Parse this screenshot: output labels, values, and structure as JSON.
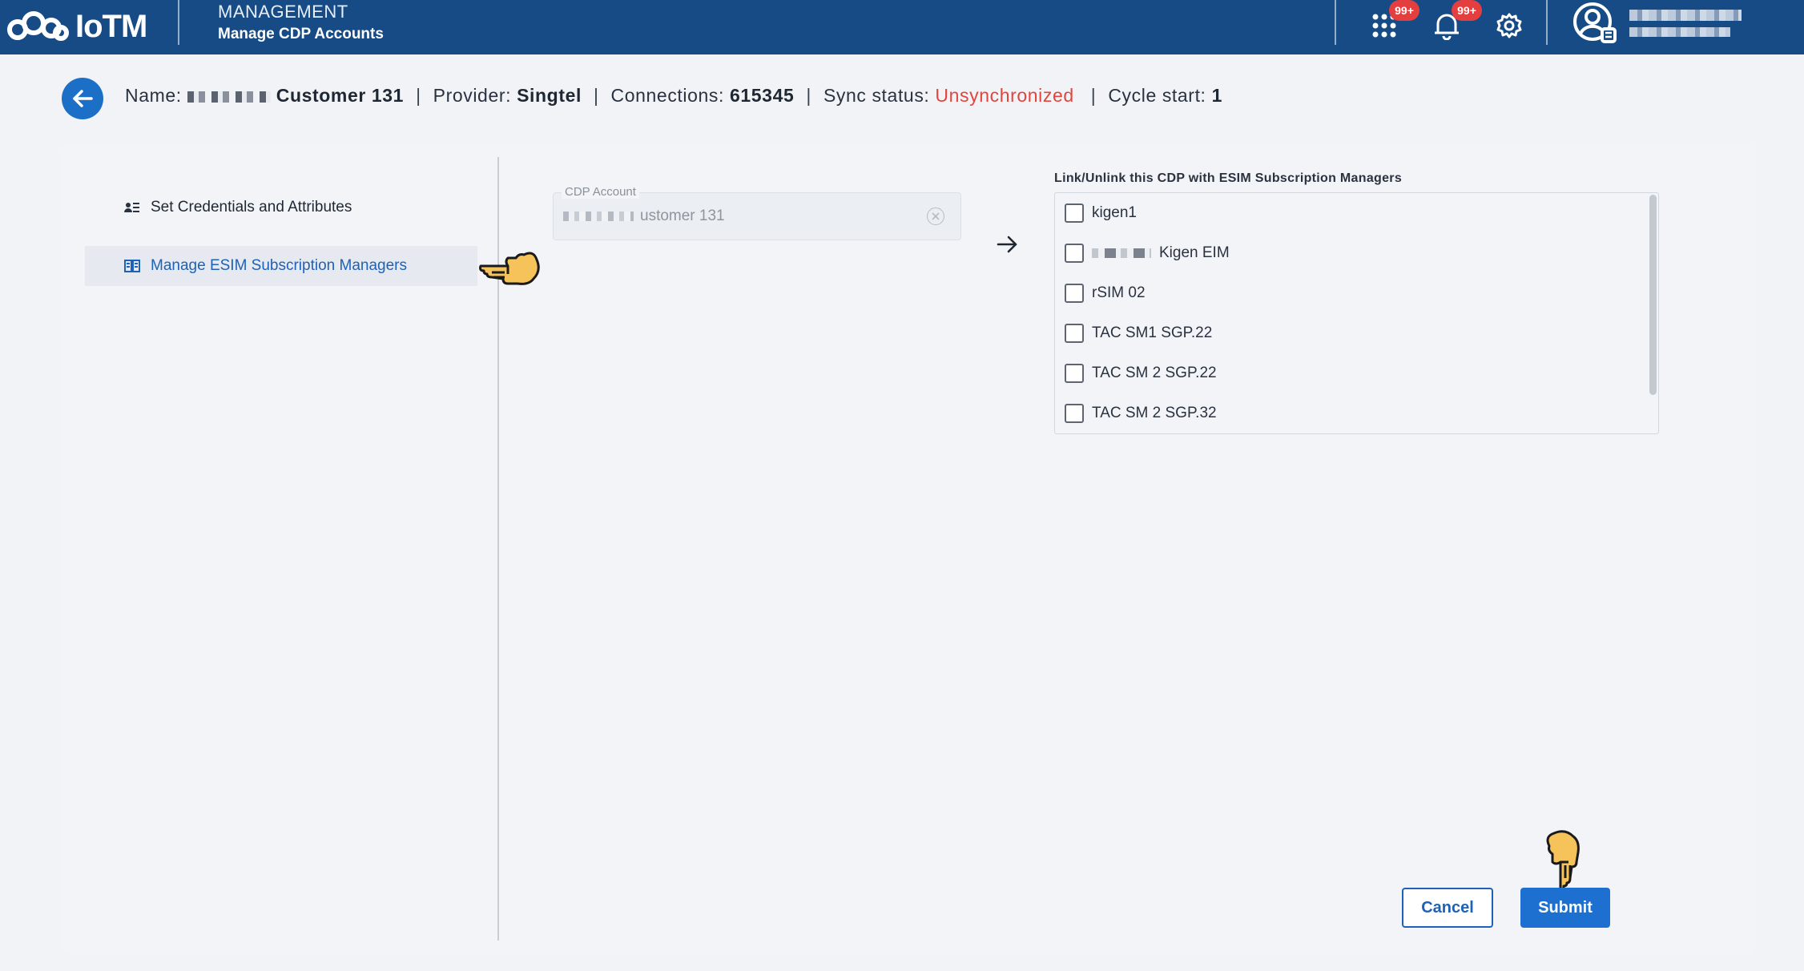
{
  "topbar": {
    "logo_text": "IoTM",
    "section": "MANAGEMENT",
    "page": "Manage CDP Accounts",
    "apps_badge": "99+",
    "notifications_badge": "99+"
  },
  "header": {
    "name_label": "Name:",
    "name_value": "Customer 131",
    "provider_label": "Provider:",
    "provider_value": "Singtel",
    "connections_label": "Connections:",
    "connections_value": "615345",
    "sync_label": "Sync status:",
    "sync_value": "Unsynchronized",
    "cycle_label": "Cycle start:",
    "cycle_value": "1",
    "separator": "|"
  },
  "sidebar": {
    "items": [
      {
        "label": "Set Credentials and Attributes",
        "icon": "user-list-icon",
        "active": false
      },
      {
        "label": "Manage ESIM Subscription Managers",
        "icon": "book-icon",
        "active": true
      }
    ]
  },
  "cdp": {
    "label": "CDP Account",
    "value_suffix": "ustomer 131"
  },
  "link_list": {
    "title": "Link/Unlink this CDP with ESIM Subscription Managers",
    "items": [
      {
        "label": "kigen1",
        "checked": false
      },
      {
        "label": "Kigen EIM",
        "checked": false
      },
      {
        "label": "rSIM 02",
        "checked": false
      },
      {
        "label": "TAC SM1 SGP.22",
        "checked": false
      },
      {
        "label": "TAC SM 2 SGP.22",
        "checked": false
      },
      {
        "label": "TAC SM 2 SGP.32",
        "checked": false
      }
    ]
  },
  "actions": {
    "cancel": "Cancel",
    "submit": "Submit"
  },
  "colors": {
    "topbar": "#164b86",
    "accent": "#1d6fd0",
    "sync_error": "#e2453c"
  }
}
